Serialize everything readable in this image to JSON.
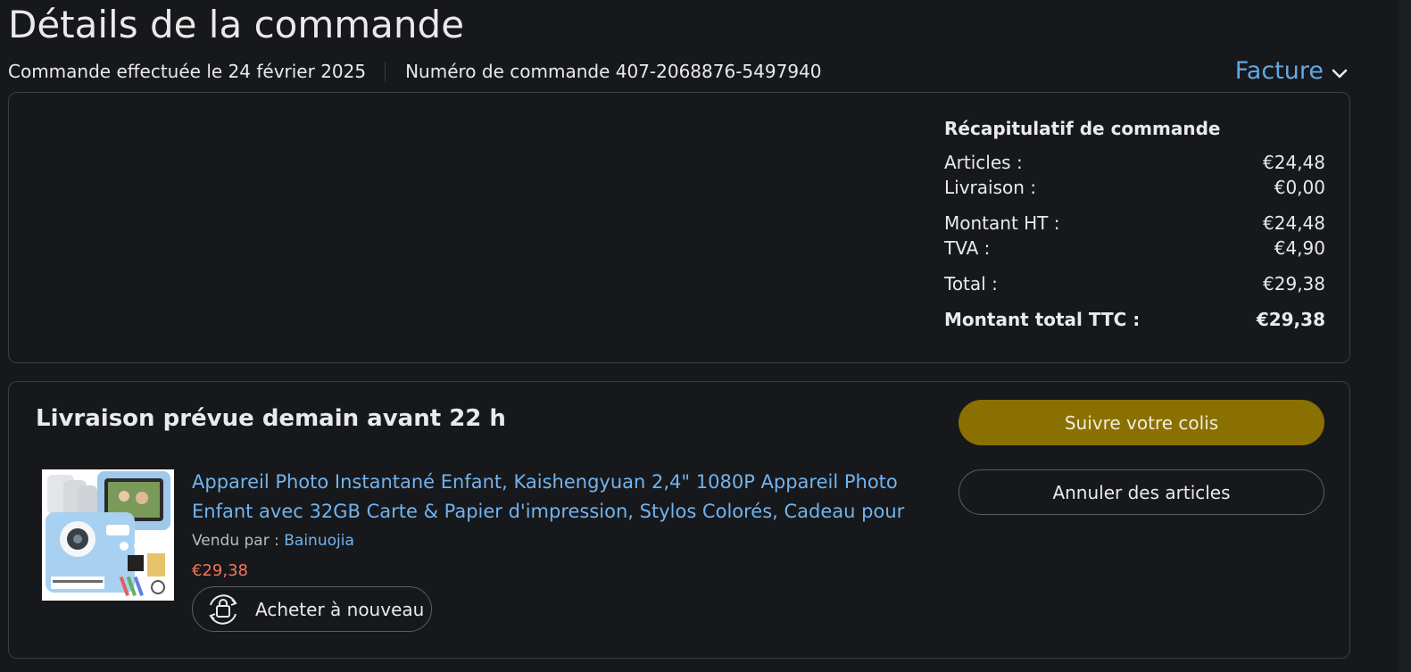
{
  "page": {
    "title": "Détails de la commande",
    "order_date": "Commande effectuée le 24 février 2025",
    "order_number": "Numéro de commande 407-2068876-5497940",
    "invoice_label": "Facture"
  },
  "summary": {
    "heading": "Récapitulatif de commande",
    "rows": [
      {
        "label": "Articles :",
        "value": "€24,48"
      },
      {
        "label": "Livraison :",
        "value": "€0,00"
      },
      {
        "label": "Montant HT :",
        "value": "€24,48"
      },
      {
        "label": "TVA :",
        "value": "€4,90"
      },
      {
        "label": "Total :",
        "value": "€29,38"
      },
      {
        "label": "Montant total TTC :",
        "value": "€29,38"
      }
    ]
  },
  "delivery": {
    "title": "Livraison prévue demain avant 22 h",
    "track_button": "Suivre votre colis",
    "cancel_button": "Annuler des articles",
    "product": {
      "title": "Appareil Photo Instantané Enfant, Kaishengyuan 2,4\" 1080P Appareil Photo Enfant avec 32GB Carte & Papier d'impression, Stylos Colorés, Cadeau pour F",
      "sold_by_label": "Vendu par :",
      "seller": "Bainuojia",
      "price": "€29,38",
      "buy_again_button": "Acheter à nouveau"
    }
  },
  "colors": {
    "background": "#17181b",
    "link": "#72b3ee",
    "track_button": "#8a7000",
    "price": "#f0765c"
  },
  "icons": [
    "chevron-down-icon",
    "buy-again-icon",
    "product-image"
  ]
}
